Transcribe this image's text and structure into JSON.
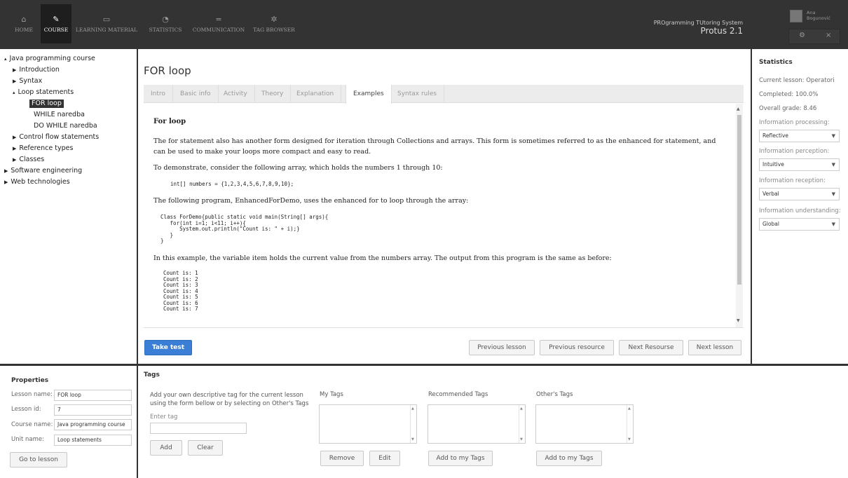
{
  "nav": {
    "items": [
      {
        "label": "HOME",
        "icon": "home-icon",
        "glyph": "⌂"
      },
      {
        "label": "COURSE",
        "icon": "edit-icon",
        "glyph": "✎"
      },
      {
        "label": "LEARNING MATERIAL",
        "icon": "calendar-icon",
        "glyph": "▭"
      },
      {
        "label": "STATISTICS",
        "icon": "pie-chart-icon",
        "glyph": "◔"
      },
      {
        "label": "COMMUNICATION",
        "icon": "lines-icon",
        "glyph": "="
      },
      {
        "label": "TAG BROWSER",
        "icon": "gear-icon",
        "glyph": "✲"
      }
    ],
    "active": "COURSE"
  },
  "brand": {
    "subtitle": "PROgramming TUtoring System",
    "name": "Protus 2.1"
  },
  "user": {
    "first": "Ana",
    "last": "Bogunović",
    "settings_glyph": "⚙",
    "close_glyph": "×"
  },
  "tree": [
    {
      "label": "Java programming course",
      "arrow": "▴",
      "arrow2": "▾"
    },
    {
      "label": "Introduction",
      "arrow": "▶"
    },
    {
      "label": "Syntax",
      "arrow": "▶"
    },
    {
      "label": "Loop statements",
      "arrow": "▴",
      "arrow2": "▾"
    },
    {
      "label": "FOR loop"
    },
    {
      "label": "WHILE naredba"
    },
    {
      "label": "DO WHILE naredba"
    },
    {
      "label": "Control flow statements",
      "arrow": "▶"
    },
    {
      "label": "Reference types",
      "arrow": "▶"
    },
    {
      "label": "Classes",
      "arrow": "▶"
    },
    {
      "label": "Software engineering",
      "arrow": "▶"
    },
    {
      "label": "Web technologies",
      "arrow": "▶"
    }
  ],
  "lesson": {
    "title": "FOR loop",
    "tabs": [
      "Intro",
      "Basic info",
      "Activity",
      "Theory",
      "Explanation",
      "Examples",
      "Syntax rules"
    ],
    "active_tab": "Examples",
    "content": {
      "heading": "For loop",
      "p1": "The for statement also has another form designed for iteration through Collections and arrays. This form is sometimes referred to as the enhanced for statement, and can be used to make your loops more compact and easy to read.",
      "p2": "To demonstrate, consider the following array, which holds the numbers 1 through 10:",
      "code1": "int[] numbers = {1,2,3,4,5,6,7,8,9,10};",
      "p3": "The following program, EnhancedForDemo, uses the enhanced for to loop through the array:",
      "code2": "Class ForDemo{public static void main(String[] args){\n   for(int i=1; i<11; i++){\n      System.out.println(\"Count is: \" + i);}\n   }\n}",
      "p4": "In this example, the variable item holds the current value from the numbers array. The output from this program is the same as before:",
      "code3": "Count is: 1\nCount is: 2\nCount is: 3\nCount is: 4\nCount is: 5\nCount is: 6\nCount is: 7"
    },
    "buttons": {
      "take_test": "Take test",
      "previous_lesson": "Previous lesson",
      "previous_resource": "Previous resource",
      "next_resource": "Next Resourse",
      "next_lesson": "Next lesson"
    }
  },
  "statistics": {
    "title": "Statistics",
    "current_lesson": "Current lesson: Operatori",
    "completed": "Completed: 100.0%",
    "overall_grade": "Overall grade: 8.46",
    "processing_label": "Information processing:",
    "processing_value": "Reflective",
    "perception_label": "Information perception:",
    "perception_value": "Intuitive",
    "reception_label": "Information reception:",
    "reception_value": "Verbal",
    "understanding_label": "Information understanding:",
    "understanding_value": "Global"
  },
  "properties": {
    "title": "Properties",
    "lesson_name_label": "Lesson name:",
    "lesson_name": "FOR loop",
    "lesson_id_label": "Lesson id:",
    "lesson_id": "7",
    "course_name_label": "Course name:",
    "course_name": "Java programming course",
    "unit_name_label": "Unit name:",
    "unit_name": "Loop statements",
    "go_button": "Go to lesson"
  },
  "tags": {
    "title": "Tags",
    "instructions": "Add your own descriptive tag for the current lesson using the form bellow or by selecting on Other's Tags",
    "enter_tag_placeholder": "Enter tag",
    "add": "Add",
    "clear": "Clear",
    "my_tags": "My Tags",
    "recommended_tags": "Recommended Tags",
    "others_tags": "Other's Tags",
    "remove": "Remove",
    "edit": "Edit",
    "add_to_my_tags": "Add to my Tags"
  },
  "colors": {
    "topbar": "#333333",
    "accent": "#3a7fd5",
    "selected_bg": "#333333"
  }
}
